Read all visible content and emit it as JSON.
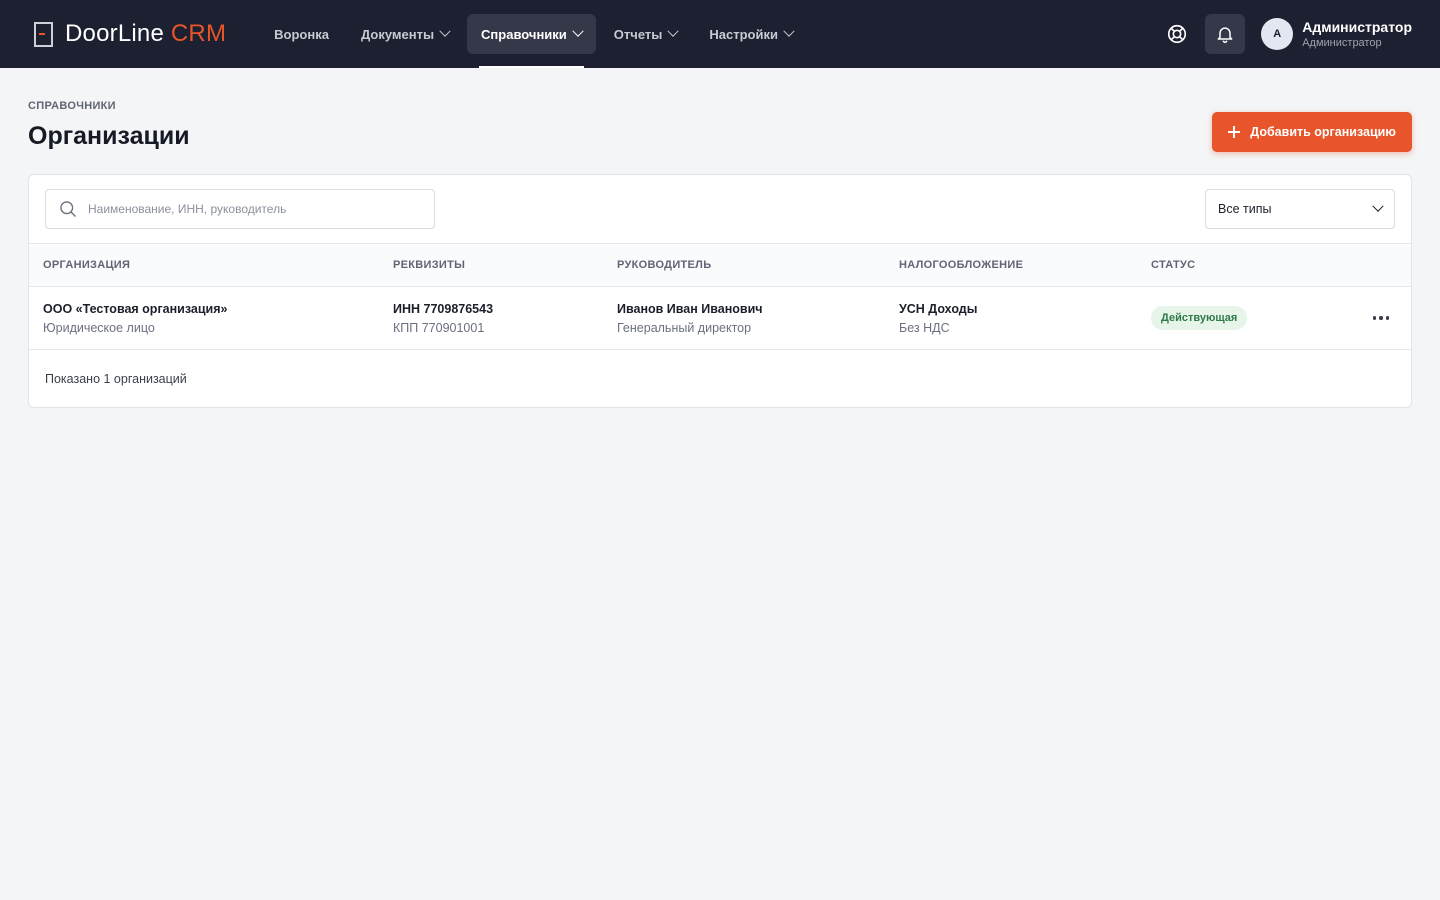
{
  "app": {
    "logo_main": "DoorLine ",
    "logo_accent": "CRM"
  },
  "nav": {
    "items": [
      {
        "label": "Воронка",
        "has_dropdown": false,
        "active": false
      },
      {
        "label": "Документы",
        "has_dropdown": true,
        "active": false
      },
      {
        "label": "Справочники",
        "has_dropdown": true,
        "active": true
      },
      {
        "label": "Отчеты",
        "has_dropdown": true,
        "active": false
      },
      {
        "label": "Настройки",
        "has_dropdown": true,
        "active": false
      }
    ]
  },
  "user": {
    "initial": "А",
    "name": "Администратор",
    "role": "Администратор"
  },
  "page": {
    "breadcrumb": "СПРАВОЧНИКИ",
    "title": "Организации",
    "add_button": "Добавить организацию"
  },
  "filters": {
    "search_placeholder": "Наименование, ИНН, руководитель",
    "search_value": "",
    "type_select": "Все типы"
  },
  "table": {
    "headers": [
      "ОРГАНИЗАЦИЯ",
      "РЕКВИЗИТЫ",
      "РУКОВОДИТЕЛЬ",
      "НАЛОГООБЛОЖЕНИЕ",
      "СТАТУС"
    ],
    "rows": [
      {
        "org_name": "ООО «Тестовая организация»",
        "org_type": "Юридическое лицо",
        "inn": "ИНН 7709876543",
        "kpp": "КПП 770901001",
        "head_name": "Иванов Иван Иванович",
        "head_position": "Генеральный директор",
        "tax_mode": "УСН Доходы",
        "vat": "Без НДС",
        "status": "Действующая"
      }
    ]
  },
  "footer": {
    "count_text": "Показано 1 организаций"
  },
  "colors": {
    "topbar": "#1c2030",
    "accent": "#e8552a",
    "status_bg": "#e6f4ea",
    "status_text": "#2f7a48"
  }
}
